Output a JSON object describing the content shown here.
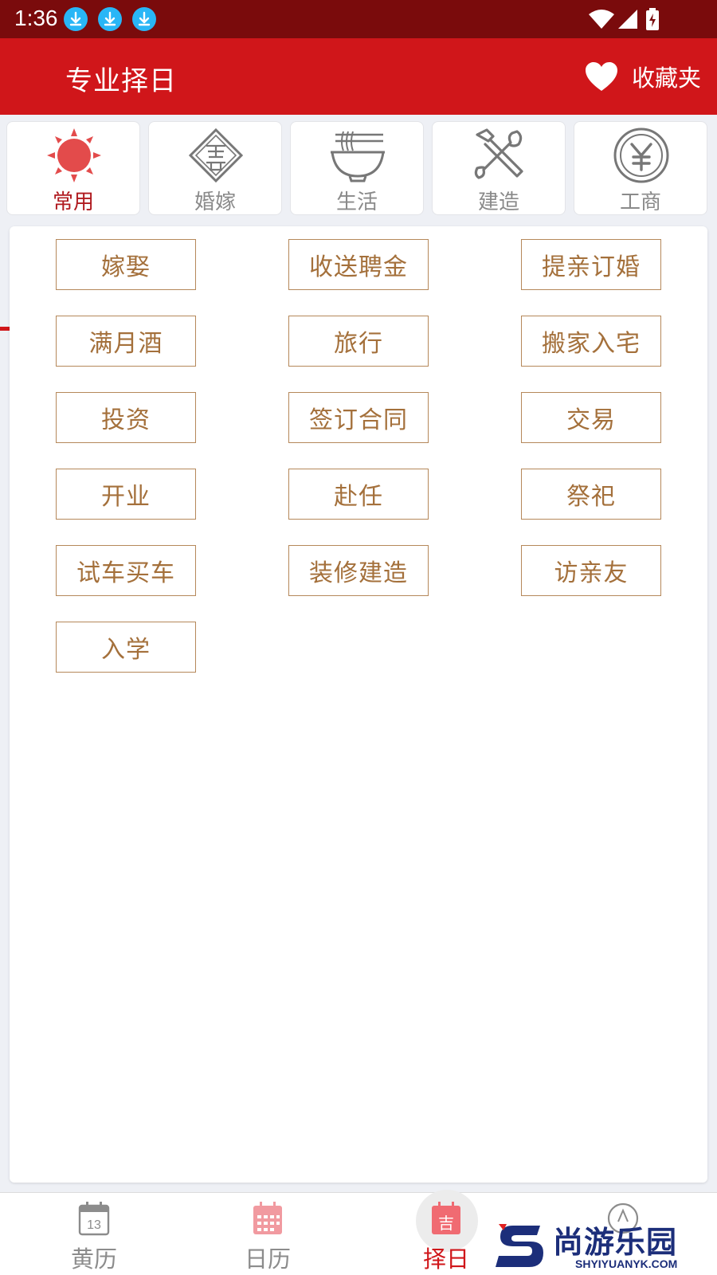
{
  "status_bar": {
    "time": "1:36"
  },
  "app_bar": {
    "title": "专业择日",
    "favorites_label": "收藏夹"
  },
  "categories": [
    {
      "label": "常用",
      "icon": "sun-icon",
      "active": true
    },
    {
      "label": "婚嫁",
      "icon": "double-happiness-icon",
      "active": false
    },
    {
      "label": "生活",
      "icon": "noodle-bowl-icon",
      "active": false
    },
    {
      "label": "建造",
      "icon": "tools-icon",
      "active": false
    },
    {
      "label": "工商",
      "icon": "yuan-coin-icon",
      "active": false
    }
  ],
  "options": [
    "嫁娶",
    "收送聘金",
    "提亲订婚",
    "满月酒",
    "旅行",
    "搬家入宅",
    "投资",
    "签订合同",
    "交易",
    "开业",
    "赴任",
    "祭祀",
    "试车买车",
    "装修建造",
    "访亲友",
    "入学"
  ],
  "bottom_nav": [
    {
      "label": "黄历",
      "icon": "calendar-day-icon",
      "badge": "13",
      "active": false
    },
    {
      "label": "日历",
      "icon": "calendar-grid-icon",
      "active": false
    },
    {
      "label": "择日",
      "icon": "auspicious-calendar-icon",
      "badge": "吉",
      "active": true
    },
    {
      "label": "",
      "icon": "compass-icon",
      "active": false
    }
  ],
  "watermark": {
    "brand": "尚游乐园",
    "url": "SHYIYUANYK.COM"
  },
  "colors": {
    "status_bar": "#7a0b0c",
    "app_bar": "#d0161a",
    "option_border": "#b5885a",
    "option_text": "#a4703b",
    "active_tab": "#b01a1f"
  }
}
